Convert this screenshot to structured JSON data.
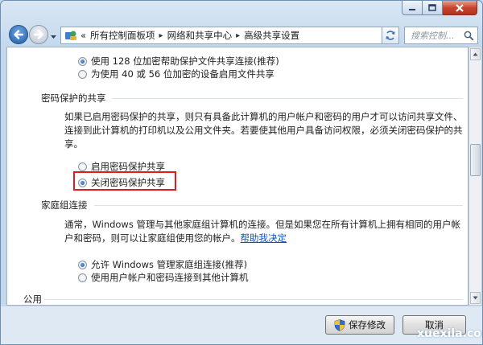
{
  "address_bar": {
    "prefix": "«",
    "breadcrumbs": [
      "所有控制面板项",
      "网络和共享中心",
      "高级共享设置"
    ]
  },
  "search": {
    "placeholder": "搜索控制..."
  },
  "options_top": [
    {
      "label": "使用 128 位加密帮助保护文件共享连接(推荐)",
      "checked": true
    },
    {
      "label": "为使用 40 或 56 位加密的设备启用文件共享",
      "checked": false
    }
  ],
  "password_section": {
    "title": "密码保护的共享",
    "description": "如果已启用密码保护的共享，则只有具备此计算机的用户帐户和密码的用户才可以访问共享文件、连接到此计算机的打印机以及公用文件夹。若要使其他用户具备访问权限，必须关闭密码保护的共享。",
    "options": [
      {
        "label": "启用密码保护共享",
        "checked": false
      },
      {
        "label": "关闭密码保护共享",
        "checked": true
      }
    ]
  },
  "homegroup_section": {
    "title": "家庭组连接",
    "description": "通常，Windows 管理与其他家庭组计算机的连接。但是如果您在所有计算机上拥有相同的用户帐户和密码，则可以让家庭组使用您的帐户。",
    "help_link": "帮助我决定",
    "options": [
      {
        "label": "允许 Windows 管理家庭组连接(推荐)",
        "checked": true
      },
      {
        "label": "使用用户帐户和密码连接到其他计算机",
        "checked": false
      }
    ]
  },
  "public_section": {
    "title": "公用"
  },
  "buttons": {
    "save": "保存修改",
    "cancel": "取消"
  },
  "watermark": "xuexila.com",
  "colors": {
    "highlight_box": "#e01b1b",
    "link": "#0a52c4"
  }
}
